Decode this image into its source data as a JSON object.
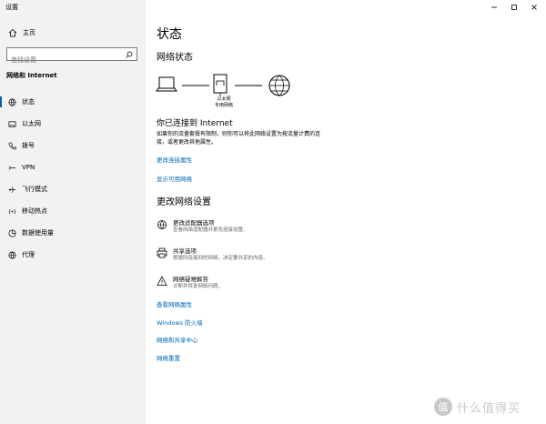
{
  "window": {
    "title": "设置"
  },
  "sidebar": {
    "home_label": "主页",
    "search_placeholder": "查找设置",
    "section_title": "网络和 Internet",
    "items": [
      {
        "label": "状态",
        "icon": "status-globe-icon",
        "active": true
      },
      {
        "label": "以太网",
        "icon": "ethernet-icon"
      },
      {
        "label": "拨号",
        "icon": "dialup-phone-icon"
      },
      {
        "label": "VPN",
        "icon": "vpn-icon"
      },
      {
        "label": "飞行模式",
        "icon": "airplane-icon"
      },
      {
        "label": "移动热点",
        "icon": "hotspot-icon"
      },
      {
        "label": "数据使用量",
        "icon": "data-usage-icon"
      },
      {
        "label": "代理",
        "icon": "proxy-globe-icon"
      }
    ]
  },
  "main": {
    "title": "状态",
    "network_status_heading": "网络状态",
    "diagram": {
      "ethernet_label": "以太网",
      "network_label": "专用网络"
    },
    "connected_text": "你已连接到 Internet",
    "description": "如果你的流量套餐有限制，则你可以将此网络设置为按流量计费的连接，或者更改其他属性。",
    "links_top": [
      "更改连接属性",
      "显示可用网络"
    ],
    "change_settings_heading": "更改网络设置",
    "settings": [
      {
        "title": "更改适配器选项",
        "desc": "查看网络适配器并更改连接设置。",
        "icon": "adapter-globe-icon"
      },
      {
        "title": "共享选项",
        "desc": "根据所连接到的网络，决定要共享的内容。",
        "icon": "printer-icon"
      },
      {
        "title": "网络疑难解答",
        "desc": "诊断并修复网络问题。",
        "icon": "warning-icon"
      }
    ],
    "links_bottom": [
      "查看网络属性",
      "Windows 防火墙",
      "网络和共享中心",
      "网络重置"
    ]
  },
  "watermark": {
    "symbol": "值",
    "text": "什么值得买"
  }
}
